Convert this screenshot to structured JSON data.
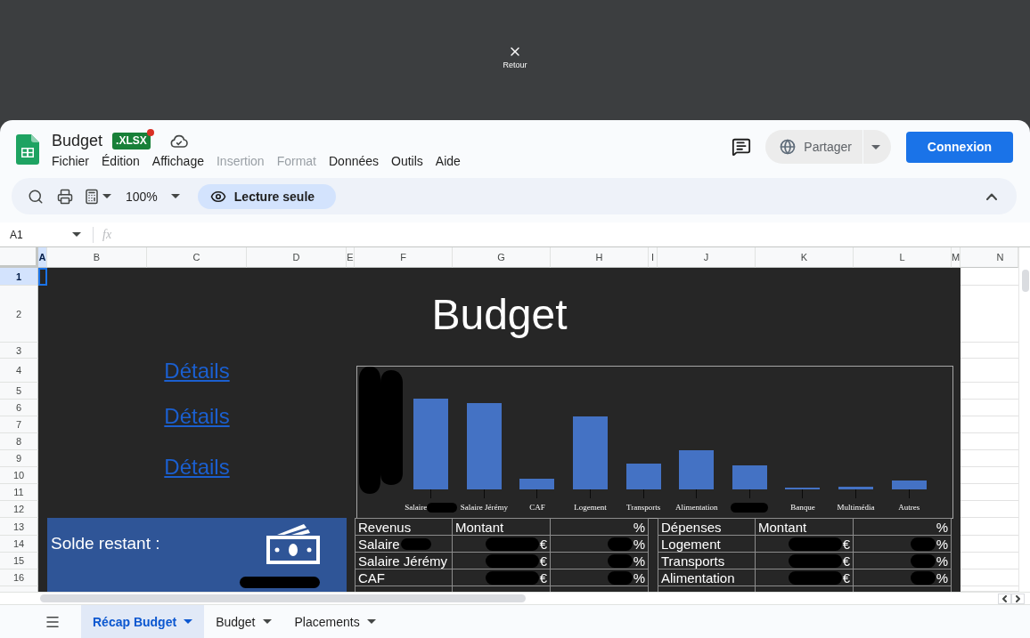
{
  "overlay": {
    "close_label": "Retour"
  },
  "document": {
    "title": "Budget",
    "file_badge": ".XLSX"
  },
  "menu": [
    {
      "label": "Fichier",
      "disabled": false
    },
    {
      "label": "Édition",
      "disabled": false
    },
    {
      "label": "Affichage",
      "disabled": false
    },
    {
      "label": "Insertion",
      "disabled": true
    },
    {
      "label": "Format",
      "disabled": true
    },
    {
      "label": "Données",
      "disabled": false
    },
    {
      "label": "Outils",
      "disabled": false
    },
    {
      "label": "Aide",
      "disabled": false
    }
  ],
  "header_actions": {
    "share_label": "Partager",
    "sign_in_label": "Connexion"
  },
  "toolbar": {
    "zoom": "100%",
    "mode_label": "Lecture seule"
  },
  "formula_bar": {
    "cell_reference": "A1",
    "function_label": "fx"
  },
  "columns": [
    {
      "label": "A",
      "selected": true
    },
    {
      "label": "B",
      "selected": false
    },
    {
      "label": "C",
      "selected": false
    },
    {
      "label": "D",
      "selected": false
    },
    {
      "label": "E",
      "selected": false
    },
    {
      "label": "F",
      "selected": false
    },
    {
      "label": "G",
      "selected": false
    },
    {
      "label": "H",
      "selected": false
    },
    {
      "label": "I",
      "selected": false
    },
    {
      "label": "J",
      "selected": false
    },
    {
      "label": "K",
      "selected": false
    },
    {
      "label": "L",
      "selected": false
    },
    {
      "label": "M",
      "selected": false
    },
    {
      "label": "N",
      "selected": false
    }
  ],
  "rows": [
    {
      "label": "1",
      "selected": true
    },
    {
      "label": "2",
      "selected": false
    },
    {
      "label": "3",
      "selected": false
    },
    {
      "label": "4",
      "selected": false
    },
    {
      "label": "5",
      "selected": false
    },
    {
      "label": "6",
      "selected": false
    },
    {
      "label": "7",
      "selected": false
    },
    {
      "label": "8",
      "selected": false
    },
    {
      "label": "9",
      "selected": false
    },
    {
      "label": "10",
      "selected": false
    },
    {
      "label": "11",
      "selected": false
    },
    {
      "label": "12",
      "selected": false
    },
    {
      "label": "13",
      "selected": false
    },
    {
      "label": "14",
      "selected": false
    },
    {
      "label": "15",
      "selected": false
    },
    {
      "label": "16",
      "selected": false
    }
  ],
  "sheet": {
    "title": "Budget",
    "links": [
      "Détails",
      "Détails",
      "Détails"
    ],
    "chart": {
      "axis_redacted": true,
      "labels": [
        {
          "text": "Salaire",
          "redacted": true
        },
        {
          "text": "Salaire Jérémy",
          "redacted": false
        },
        {
          "text": "CAF",
          "redacted": false
        },
        {
          "text": "Logement",
          "redacted": false
        },
        {
          "text": "Transports",
          "redacted": false
        },
        {
          "text": "Alimentation",
          "redacted": false
        },
        {
          "redacted": true
        },
        {
          "text": "Banque",
          "redacted": false
        },
        {
          "text": "Multimédia",
          "redacted": false
        },
        {
          "text": "Autres",
          "redacted": false
        }
      ]
    },
    "balance": {
      "label": "Solde restant :",
      "amount_redacted": true
    },
    "tables": [
      {
        "header": [
          "Revenus",
          "Montant",
          "%"
        ],
        "rows": [
          [
            {
              "text": "Salaire",
              "redacted": true
            },
            {
              "text": "€",
              "redacted": true
            },
            {
              "text": "%",
              "redacted": true
            }
          ],
          [
            {
              "text": "Salaire Jérémy",
              "redacted": false
            },
            {
              "text": "€",
              "redacted": true
            },
            {
              "text": "%",
              "redacted": true
            }
          ],
          [
            {
              "text": "CAF",
              "redacted": false
            },
            {
              "text": "€",
              "redacted": true
            },
            {
              "text": "%",
              "redacted": true
            }
          ]
        ]
      },
      {
        "header": [
          "Dépenses",
          "Montant",
          "%"
        ],
        "rows": [
          [
            {
              "text": "Logement",
              "redacted": false
            },
            {
              "text": "€",
              "redacted": true
            },
            {
              "text": "%",
              "redacted": true
            }
          ],
          [
            {
              "text": "Transports",
              "redacted": false
            },
            {
              "text": "€",
              "redacted": true
            },
            {
              "text": "%",
              "redacted": true
            }
          ],
          [
            {
              "text": "Alimentation",
              "redacted": false
            },
            {
              "text": "€",
              "redacted": true
            },
            {
              "text": "%",
              "redacted": true
            }
          ]
        ]
      }
    ]
  },
  "sheet_tabs": [
    {
      "label": "Récap Budget",
      "selected": true
    },
    {
      "label": "Budget",
      "selected": false
    },
    {
      "label": "Placements",
      "selected": false
    }
  ]
}
